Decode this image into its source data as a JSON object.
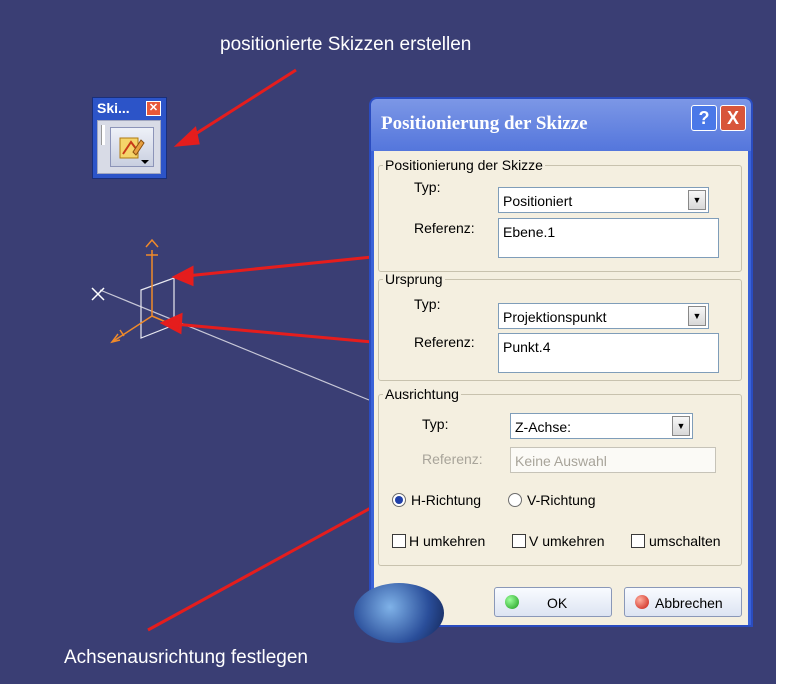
{
  "annotations": {
    "top": "positionierte Skizzen erstellen",
    "bottom": "Achsenausrichtung festlegen"
  },
  "toolbar": {
    "title": "Ski...",
    "close_icon": "close-icon",
    "button_icon": "positioned-sketch-icon"
  },
  "dialog": {
    "title": "Positionierung der Skizze",
    "help_label": "?",
    "close_label": "X",
    "groups": {
      "positioning": {
        "legend": "Positionierung der Skizze",
        "type_label": "Typ:",
        "type_value": "Positioniert",
        "ref_label": "Referenz:",
        "ref_value": "Ebene.1"
      },
      "origin": {
        "legend": "Ursprung",
        "type_label": "Typ:",
        "type_value": "Projektionspunkt",
        "ref_label": "Referenz:",
        "ref_value": "Punkt.4"
      },
      "orientation": {
        "legend": "Ausrichtung",
        "type_label": "Typ:",
        "type_value": "Z-Achse:",
        "ref_label": "Referenz:",
        "ref_placeholder": "Keine Auswahl",
        "radio_h": "H-Richtung",
        "radio_v": "V-Richtung",
        "selected_radio": "H-Richtung",
        "check_h": "H umkehren",
        "check_v": "V umkehren",
        "check_switch": "umschalten"
      }
    },
    "ok_label": "OK",
    "cancel_label": "Abbrechen"
  },
  "colors": {
    "background": "#3a3e74",
    "arrow": "#e51d1d",
    "dialog_title": "#5476dc",
    "dialog_body": "#f4efe0"
  }
}
